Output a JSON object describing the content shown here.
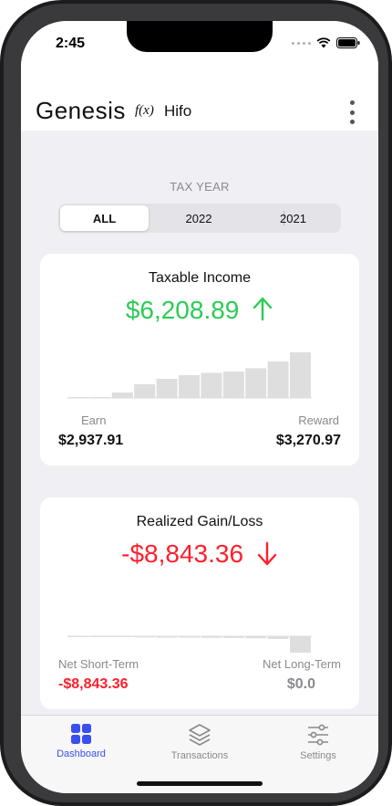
{
  "status_bar": {
    "time": "2:45"
  },
  "header": {
    "app_name": "Genesis",
    "fx_label": "f(x)",
    "method": "Hifo"
  },
  "tax_year": {
    "label": "TAX YEAR",
    "options": [
      "ALL",
      "2022",
      "2021"
    ],
    "selected": "ALL"
  },
  "taxable_income": {
    "title": "Taxable Income",
    "value": "$6,208.89",
    "trend": "up",
    "color": "#2ccb56",
    "bars": [
      0.0,
      0.02,
      0.12,
      0.3,
      0.42,
      0.5,
      0.55,
      0.58,
      0.65,
      0.8,
      1.0
    ],
    "left_label": "Earn",
    "left_value": "$2,937.91",
    "right_label": "Reward",
    "right_value": "$3,270.97"
  },
  "realized": {
    "title": "Realized Gain/Loss",
    "value": "-$8,843.36",
    "trend": "down",
    "color": "#ff1f2c",
    "bars": [
      0.02,
      0.02,
      0.04,
      0.05,
      0.06,
      0.06,
      0.07,
      0.08,
      0.09,
      0.12,
      1.0
    ],
    "left_label": "Net Short-Term",
    "left_value": "-$8,843.36",
    "right_label": "Net Long-Term",
    "right_value": "$0.0"
  },
  "tabs": [
    {
      "label": "Dashboard",
      "icon": "grid-icon",
      "active": true
    },
    {
      "label": "Transactions",
      "icon": "stack-icon",
      "active": false
    },
    {
      "label": "Settings",
      "icon": "sliders-icon",
      "active": false
    }
  ],
  "colors": {
    "accent": "#3a4ff0",
    "gain": "#2ccb56",
    "loss": "#ff1f2c"
  }
}
